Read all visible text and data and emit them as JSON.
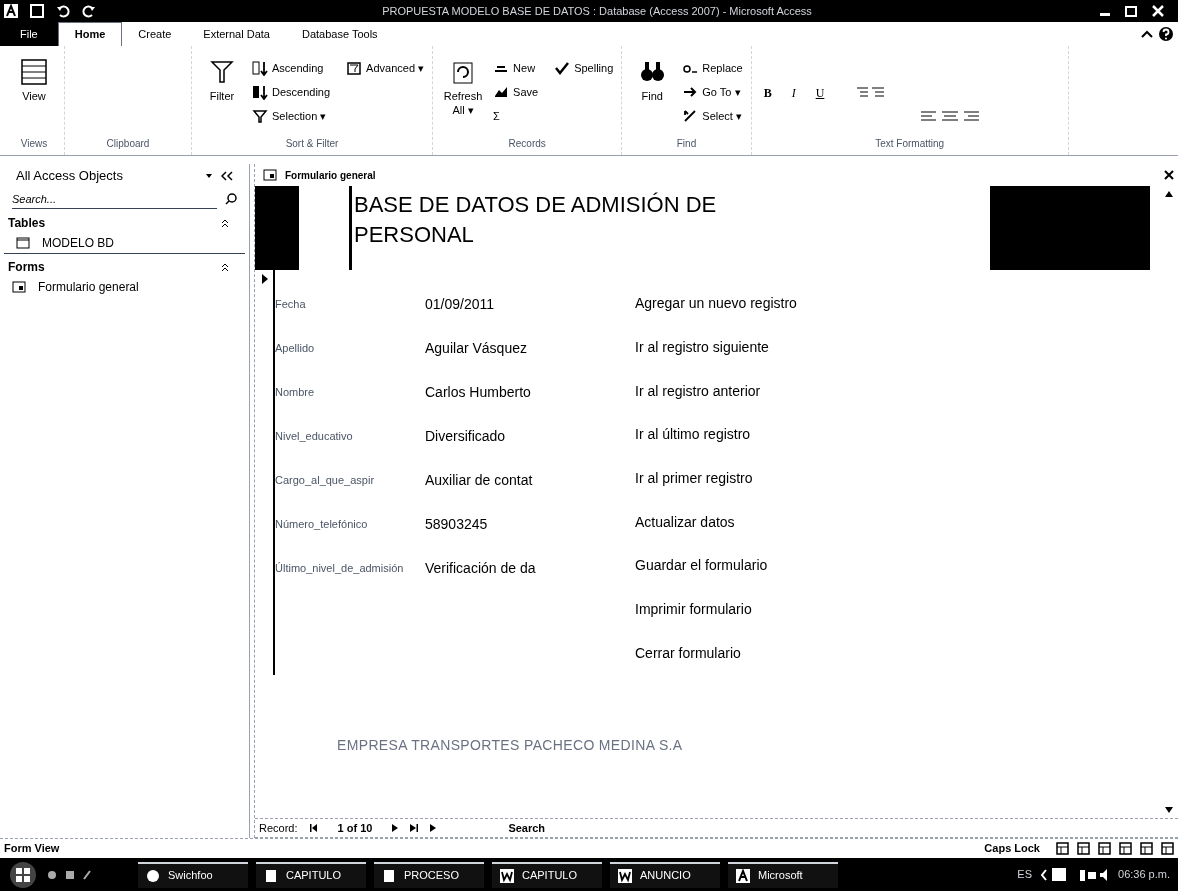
{
  "window": {
    "title": "PROPUESTA MODELO BASE DE DATOS : Database (Access 2007) - Microsoft Access"
  },
  "menu_tabs": [
    {
      "label": "File",
      "kind": "file",
      "selected": false
    },
    {
      "label": "Home",
      "kind": "tab",
      "selected": true
    },
    {
      "label": "Create",
      "kind": "tab",
      "selected": false
    },
    {
      "label": "External Data",
      "kind": "tab",
      "selected": false
    },
    {
      "label": "Database Tools",
      "kind": "tab",
      "selected": false
    }
  ],
  "ribbon": {
    "groups": [
      {
        "label": "Views",
        "commands": [
          {
            "label": "View",
            "kind": "large"
          }
        ]
      },
      {
        "label": "Clipboard"
      },
      {
        "label": "Sort & Filter",
        "commands": [
          {
            "label": "Filter",
            "kind": "large"
          },
          {
            "label": "Ascending",
            "kind": "small"
          },
          {
            "label": "Descending",
            "kind": "small"
          },
          {
            "label": "Selection ▾",
            "kind": "small"
          },
          {
            "label": "Advanced ▾",
            "kind": "small"
          }
        ]
      },
      {
        "label": "Records",
        "commands": [
          {
            "label": "Refresh All ▾",
            "kind": "large"
          },
          {
            "label": "New",
            "kind": "small"
          },
          {
            "label": "Save",
            "kind": "small"
          },
          {
            "label": "Σ",
            "kind": "small"
          },
          {
            "label": "Spelling",
            "kind": "small"
          }
        ]
      },
      {
        "label": "Find",
        "commands": [
          {
            "label": "Find",
            "kind": "large"
          },
          {
            "label": "Replace",
            "kind": "small"
          },
          {
            "label": "Go To ▾",
            "kind": "small"
          },
          {
            "label": "Select ▾",
            "kind": "small"
          }
        ]
      },
      {
        "label": "Text Formatting",
        "commands": [
          {
            "label": "B",
            "kind": "format"
          },
          {
            "label": "I",
            "kind": "format"
          },
          {
            "label": "U",
            "kind": "format"
          }
        ]
      }
    ]
  },
  "nav_pane": {
    "title": "All Access Objects",
    "search_placeholder": "Search...",
    "groups": [
      {
        "label": "Tables",
        "items": [
          {
            "label": "MODELO BD",
            "kind": "table"
          }
        ]
      },
      {
        "label": "Forms",
        "items": [
          {
            "label": "Formulario general",
            "kind": "form"
          }
        ]
      }
    ]
  },
  "document_tab": {
    "label": "Formulario general"
  },
  "form": {
    "header_title": "BASE DE DATOS DE ADMISIÓN DE PERSONAL",
    "fields": [
      {
        "label": "Fecha",
        "value": "01/09/2011"
      },
      {
        "label": "Apellido",
        "value": "Aguilar Vásquez"
      },
      {
        "label": "Nombre",
        "value": "Carlos Humberto"
      },
      {
        "label": "Nivel_educativo",
        "value": "Diversificado"
      },
      {
        "label": "Cargo_al_que_aspir",
        "value": "Auxiliar de contat"
      },
      {
        "label": "Número_telefónico",
        "value": "58903245"
      },
      {
        "label": "Último_nivel_de_admisión",
        "value": "Verificación de da"
      }
    ],
    "buttons": [
      "Agregar un nuevo registro",
      "Ir al registro siguiente",
      "Ir al registro anterior",
      "Ir al último registro",
      "Ir al primer registro",
      "Actualizar datos",
      "Guardar el formulario",
      "Imprimir formulario",
      "Cerrar formulario"
    ],
    "footer": "EMPRESA TRANSPORTES PACHECO MEDINA S.A"
  },
  "record_nav": {
    "label": "Record:",
    "position": "1 of 10",
    "search": "Search"
  },
  "status_bar": {
    "view": "Form View",
    "caps": "Caps Lock"
  },
  "taskbar": {
    "items": [
      {
        "label": "Swichfoo",
        "kind": "app"
      },
      {
        "label": "CAPITULO",
        "kind": "doc"
      },
      {
        "label": "PROCESO",
        "kind": "doc"
      },
      {
        "label": "CAPITULO",
        "kind": "word"
      },
      {
        "label": "ANUNCIO",
        "kind": "word"
      },
      {
        "label": "Microsoft",
        "kind": "access"
      }
    ],
    "language": "ES",
    "clock": "06:36 p.m."
  }
}
